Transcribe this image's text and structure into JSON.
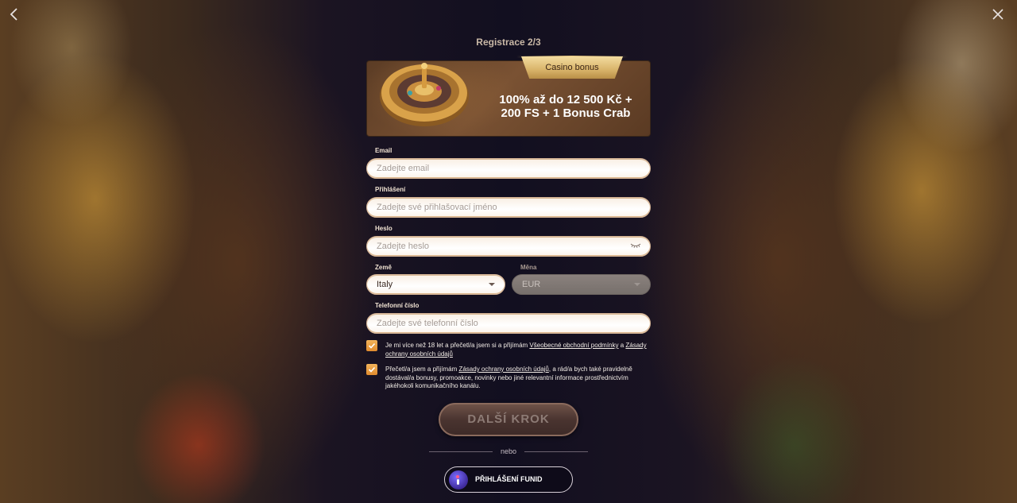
{
  "nav": {
    "back_icon": "chevron-left-icon",
    "close_icon": "close-icon"
  },
  "step_title": "Registrace 2/3",
  "bonus": {
    "badge": "Casino bonus",
    "line1": "100% až do 12 500 Kč +",
    "line2": "200 FS + 1 Bonus Crab"
  },
  "form": {
    "email": {
      "label": "Email",
      "placeholder": "Zadejte email"
    },
    "login": {
      "label": "Přihlášení",
      "placeholder": "Zadejte své přihlašovací jméno"
    },
    "password": {
      "label": "Heslo",
      "placeholder": "Zadejte heslo"
    },
    "country": {
      "label": "Země",
      "value": "Italy"
    },
    "currency": {
      "label": "Měna",
      "value": "EUR"
    },
    "phone": {
      "label": "Telefonní číslo",
      "placeholder": "Zadejte své telefonní číslo"
    }
  },
  "consents": {
    "age": {
      "text_before": "Je mi více než 18 let a přečetl/a jsem si a přijímám ",
      "link1": "Všeobecné obchodní podmínky",
      "text_mid": " a ",
      "link2": "Zásady ochrany osobních údajů",
      "checked": true
    },
    "marketing": {
      "text_before": "Přečetl/a jsem a přijímám ",
      "link": "Zásady ochrany osobních údajů",
      "text_after": ", a rád/a bych také pravidelně dostával/a bonusy, promoakce, novinky nebo jiné relevantní informace prostřednictvím jakéhokoli komunikačního kanálu.",
      "checked": true
    }
  },
  "next_button": "DALŠÍ KROK",
  "or_text": "nebo",
  "funid_button": "PŘIHLÁŠENÍ FUNID",
  "colors": {
    "accent": "#e08b2e",
    "bonus_gold": "#d9b46a"
  }
}
